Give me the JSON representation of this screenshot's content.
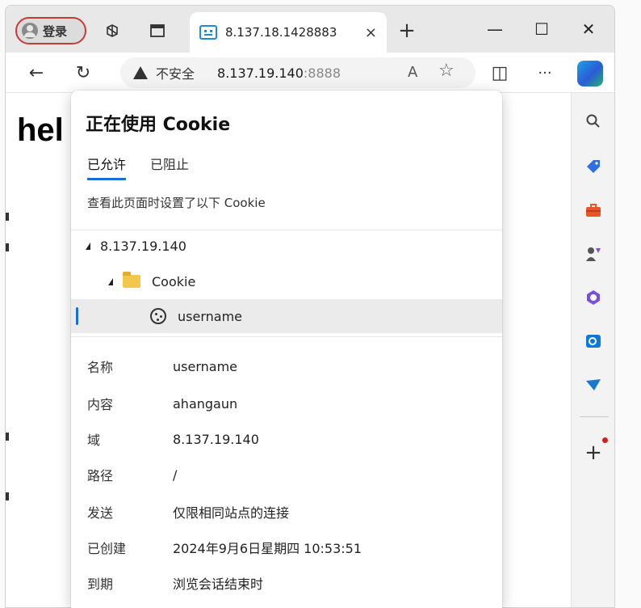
{
  "profile": {
    "label": "登录"
  },
  "tab": {
    "title": "8.137.18.1428883",
    "close": "×"
  },
  "new_tab": "+",
  "window_controls": {
    "minimize": "—",
    "maximize": "☐",
    "close": "✕"
  },
  "toolbar": {
    "back": "←",
    "refresh": "↻",
    "insecure_label": "不安全",
    "url_host": "8.137.19.140",
    "url_port": ":8888",
    "read_aloud": "A",
    "favorite": "☆",
    "split": "◫",
    "more": "···"
  },
  "page": {
    "heading": "hel"
  },
  "popup": {
    "title": "正在使用 Cookie",
    "tabs": [
      {
        "label": "已允许",
        "active": true
      },
      {
        "label": "已阻止",
        "active": false
      }
    ],
    "description": "查看此页面时设置了以下 Cookie",
    "tree": {
      "host": "8.137.19.140",
      "folder": "Cookie",
      "cookie": "username"
    },
    "details": [
      {
        "label": "名称",
        "value": "username"
      },
      {
        "label": "内容",
        "value": "ahangaun"
      },
      {
        "label": "域",
        "value": "8.137.19.140"
      },
      {
        "label": "路径",
        "value": "/"
      },
      {
        "label": "发送",
        "value": "仅限相同站点的连接"
      },
      {
        "label": "已创建",
        "value": "2024年9月6日星期四 10:53:51"
      },
      {
        "label": "到期",
        "value": "浏览会话结束时"
      }
    ]
  },
  "sidebar": {
    "icons": [
      "search-icon",
      "tag-icon",
      "toolbox-icon",
      "chess-icon",
      "copilot-icon",
      "outlook-icon",
      "send-icon"
    ],
    "add": "+"
  },
  "colors": {
    "accent": "#1a6fd6",
    "profile_border": "#c73a3a",
    "folder": "#f2c84b"
  }
}
